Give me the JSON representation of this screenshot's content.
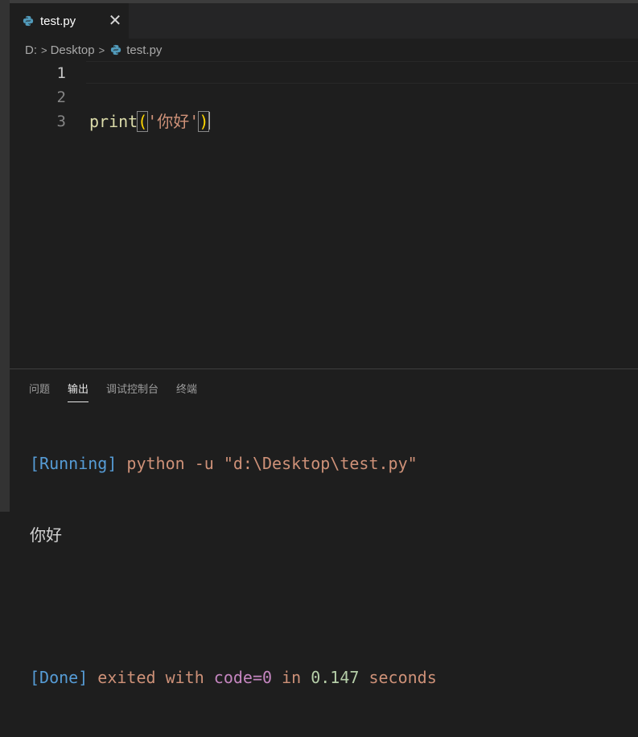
{
  "colors": {
    "editor_bg": "#1e1e1e",
    "tabbar_bg": "#252526",
    "keyword_fn": "#dcdcaa",
    "string": "#ce9178",
    "bracket": "#ffd700",
    "output_blue": "#569cd6",
    "output_purple": "#c586c0",
    "output_green": "#b5cea8"
  },
  "tab": {
    "label": "test.py",
    "icon": "python-icon",
    "close_glyph": "✕"
  },
  "breadcrumb": {
    "drive": "D:",
    "folder": "Desktop",
    "file": "test.py",
    "sep": ">"
  },
  "editor": {
    "line_numbers": [
      "1",
      "2",
      "3"
    ],
    "line1": {
      "fn": "print",
      "open": "(",
      "string": "'你好'",
      "close": ")"
    }
  },
  "panel": {
    "tabs": [
      "问题",
      "输出",
      "调试控制台",
      "终端"
    ],
    "active_tab": "输出",
    "output": {
      "running_tag": "[Running]",
      "command": " python -u \"d:\\Desktop\\test.py\"",
      "result": "你好",
      "done_tag": "[Done]",
      "exited_text": " exited with ",
      "code_label": "code=0",
      "in_text": " in ",
      "duration": "0.147",
      "seconds_text": " seconds"
    }
  }
}
